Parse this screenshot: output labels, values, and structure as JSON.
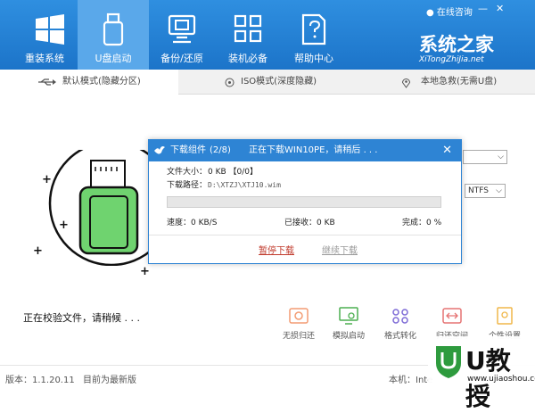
{
  "header": {
    "nav": [
      {
        "label": "重装系统",
        "icon": "windows-logo-icon"
      },
      {
        "label": "U盘启动",
        "icon": "usb-drive-icon",
        "active": true
      },
      {
        "label": "备份/还原",
        "icon": "backup-restore-icon"
      },
      {
        "label": "装机必备",
        "icon": "apps-grid-icon"
      },
      {
        "label": "帮助中心",
        "icon": "help-document-icon"
      }
    ],
    "brand": "系统之家",
    "brand_sub": "XiTongZhiJia.net",
    "online_consult": "在线咨询",
    "colors": {
      "topbar": "#1c74c9",
      "active_nav": "#5aa8ea"
    }
  },
  "tabs": [
    {
      "label": "默认模式(隐藏分区)",
      "icon": "usb-icon",
      "active": true
    },
    {
      "label": "ISO模式(深度隐藏)",
      "icon": "disc-icon"
    },
    {
      "label": "本地急救(无需U盘)",
      "icon": "location-pin-icon"
    }
  ],
  "format_select": {
    "value": "NTFS"
  },
  "status_text": "正在校验文件，请稍候 . . .",
  "actions": [
    {
      "label": "无损归还",
      "icon": "restore-icon"
    },
    {
      "label": "模拟启动",
      "icon": "simulate-boot-icon"
    },
    {
      "label": "格式转化",
      "icon": "format-convert-icon"
    },
    {
      "label": "归还空间",
      "icon": "return-space-icon"
    },
    {
      "label": "个性设置",
      "icon": "personal-settings-icon"
    }
  ],
  "footer": {
    "version": "版本：1.1.20.11",
    "latest": "目前为最新版",
    "machine": "本机：Inte"
  },
  "dialog": {
    "title": "下载组件",
    "progress_count": "(2/8)",
    "message": "正在下载WIN10PE，请稍后 . . .",
    "file_size_label": "文件大小：",
    "file_size_value": "0 KB 【0/0】",
    "path_label": "下载路径：",
    "path_value": "D:\\XTZJ\\XTJ10.wim",
    "progress": 0,
    "speed": "速度：0 KB/S",
    "received": "已接收：0 KB",
    "completed": "完成：0 %",
    "pause_label": "暂停下载",
    "resume_label": "继续下载"
  },
  "watermark": {
    "text": "U教授",
    "url": "www.ujiaoshou.com"
  }
}
